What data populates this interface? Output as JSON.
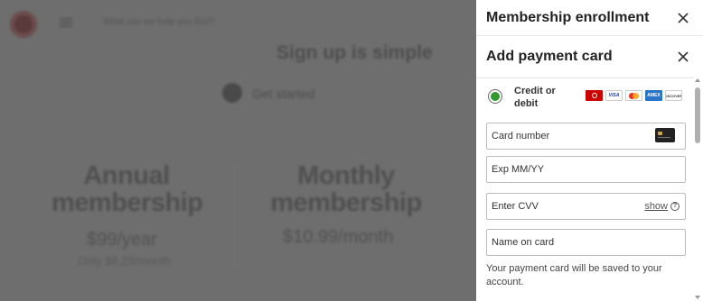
{
  "background": {
    "search_placeholder": "What can we help you find?",
    "heading": "Sign up is simple",
    "step_label": "Get started",
    "annual": {
      "title_line1": "Annual",
      "title_line2": "membership",
      "price": "$99/year",
      "sub": "Only $8.25/month"
    },
    "monthly": {
      "title_line1": "Monthly",
      "title_line2": "membership",
      "price": "$10.99/month"
    }
  },
  "panel": {
    "title": "Membership enrollment",
    "section_title": "Add payment card",
    "payment_option": {
      "label": "Credit or debit",
      "selected": true
    },
    "card_brands": [
      "target-card-icon",
      "visa-icon",
      "mastercard-icon",
      "amex-icon",
      "discover-icon"
    ],
    "card_brand_text": {
      "visa": "VISA",
      "amex": "AMEX",
      "discover": "DISCOVER"
    },
    "fields": {
      "card_number": "Card number",
      "expiry": "Exp MM/YY",
      "cvv": "Enter CVV",
      "name": "Name on card"
    },
    "show_label": "show",
    "help_glyph": "?",
    "save_note": "Your payment card will be saved to your account."
  },
  "colors": {
    "accent_green": "#2f9a2f",
    "target_red": "#cc0000"
  }
}
